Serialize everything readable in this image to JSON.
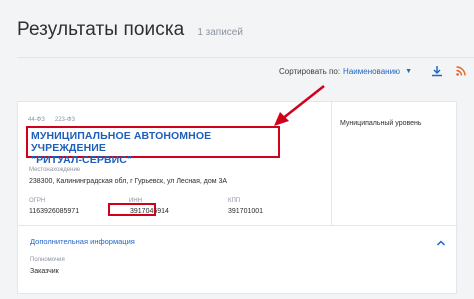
{
  "header": {
    "title": "Результаты поиска",
    "count": "1 записей"
  },
  "toolbar": {
    "sort_label": "Сортировать по:",
    "sort_value": "Наименованию",
    "sort_chevron": "▼"
  },
  "result": {
    "law_1": "44-ФЗ",
    "law_2": "223-ФЗ",
    "org_line_1": "МУНИЦИПАЛЬНОЕ АВТОНОМНОЕ УЧРЕЖДЕНИЕ",
    "org_line_2": "\"РИТУАЛ-СЕРВИС\"",
    "location_label": "Местонахождение",
    "location_value": "238300, Калининградская обл, г Гурьевск, ул Лесная, дом 3А",
    "ogrn_label": "ОГРН",
    "ogrn_value": "1163926085971",
    "inn_label": "ИНН",
    "inn_value": "3917045914",
    "kpp_label": "КПП",
    "kpp_value": "391701001",
    "level_label": "Муниципальный уровень",
    "extra_title": "Дополнительная информация",
    "authority_label": "Полномочия",
    "authority_value": "Заказчик"
  },
  "colors": {
    "accent": "#2167c5",
    "highlight": "#d0021b",
    "rss": "#e8622a"
  },
  "icons": [
    "chevron-down-icon",
    "download-icon",
    "rss-icon",
    "chevron-up-icon",
    "arrow-icon"
  ]
}
